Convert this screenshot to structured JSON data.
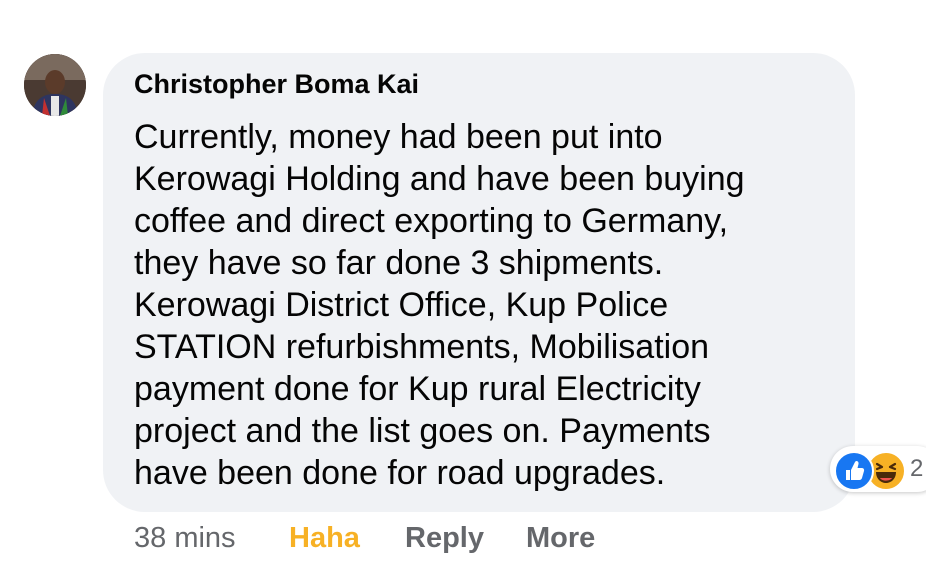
{
  "comment": {
    "author": "Christopher Boma Kai",
    "text_lines": [
      "Currently, money had been put into",
      "Kerowagi Holding and have been buying",
      "coffee and direct exporting to Germany,",
      "they have so far done 3 shipments.",
      "Kerowagi District Office, Kup Police",
      "STATION refurbishments, Mobilisation",
      "payment done for Kup rural Electricity",
      "project and the list goes on. Payments",
      "have been done for road upgrades."
    ],
    "reactions": {
      "icons": [
        "like-icon",
        "haha-icon"
      ],
      "count": "2"
    }
  },
  "actions": {
    "timestamp": "38 mins",
    "reaction_label": "Haha",
    "reply_label": "Reply",
    "more_label": "More"
  },
  "colors": {
    "bubble_bg": "#f0f2f5",
    "text": "#050505",
    "secondary_text": "#65676b",
    "haha_accent": "#f7b125",
    "like_blue": "#1877f2"
  }
}
